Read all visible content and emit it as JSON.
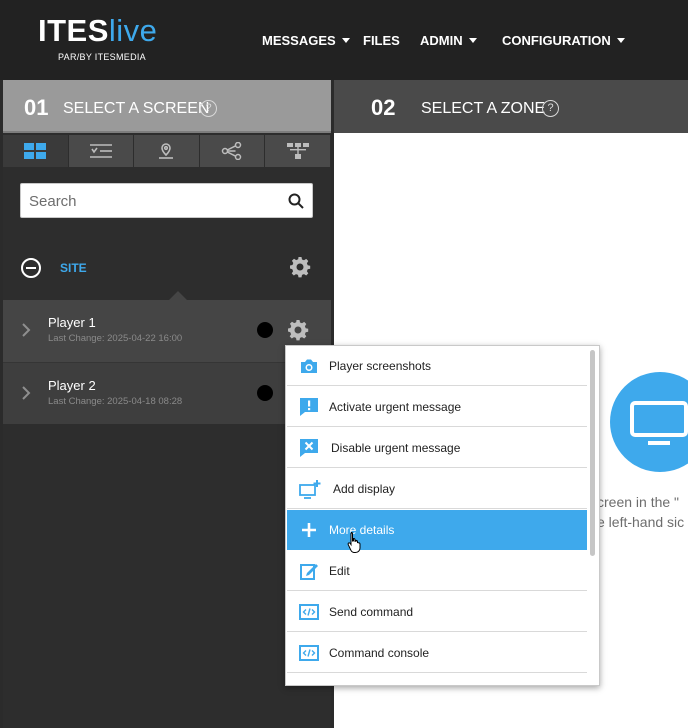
{
  "header": {
    "logo_main_a": "ITES",
    "logo_main_b": "live",
    "logo_sub": "PAR/BY ITESMEDIA",
    "nav": [
      {
        "label": "MESSAGES",
        "dropdown": true
      },
      {
        "label": "FILES",
        "dropdown": false
      },
      {
        "label": "ADMIN",
        "dropdown": true
      },
      {
        "label": "CONFIGURATION",
        "dropdown": true
      }
    ]
  },
  "left_panel": {
    "step_number": "01",
    "step_title": "SELECT A SCREEN",
    "help": "?",
    "tabs": [
      "grid-view-icon",
      "filter-list-icon",
      "map-pin-icon",
      "share-icon",
      "hierarchy-icon"
    ],
    "search": {
      "placeholder": "Search",
      "value": ""
    },
    "site": {
      "label": "SITE"
    },
    "players": [
      {
        "name": "Player 1",
        "last_change": "Last Change: 2025-04-22 16:00",
        "status_color": "#000000"
      },
      {
        "name": "Player 2",
        "last_change": "Last Change: 2025-04-18 08:28",
        "status_color": "#000000"
      }
    ]
  },
  "right_panel": {
    "step_number": "02",
    "step_title": "SELECT A ZONE",
    "help": "?",
    "hint_line1": "creen in the \"",
    "hint_line2": "e left-hand sic"
  },
  "context_menu": {
    "items": [
      {
        "label": "Player screenshots",
        "icon": "camera-icon"
      },
      {
        "label": "Activate urgent message",
        "icon": "urgent-message-icon"
      },
      {
        "label": "Disable urgent message",
        "icon": "disable-message-icon"
      },
      {
        "label": "Add display",
        "icon": "add-display-icon"
      },
      {
        "label": "More details",
        "icon": "plus-icon",
        "hovered": true
      },
      {
        "label": "Edit",
        "icon": "edit-icon"
      },
      {
        "label": "Send command",
        "icon": "code-icon"
      },
      {
        "label": "Command console",
        "icon": "console-icon"
      }
    ]
  },
  "colors": {
    "accent": "#3ea9ec",
    "topbar": "#222222",
    "panel": "#2d2d2d"
  }
}
